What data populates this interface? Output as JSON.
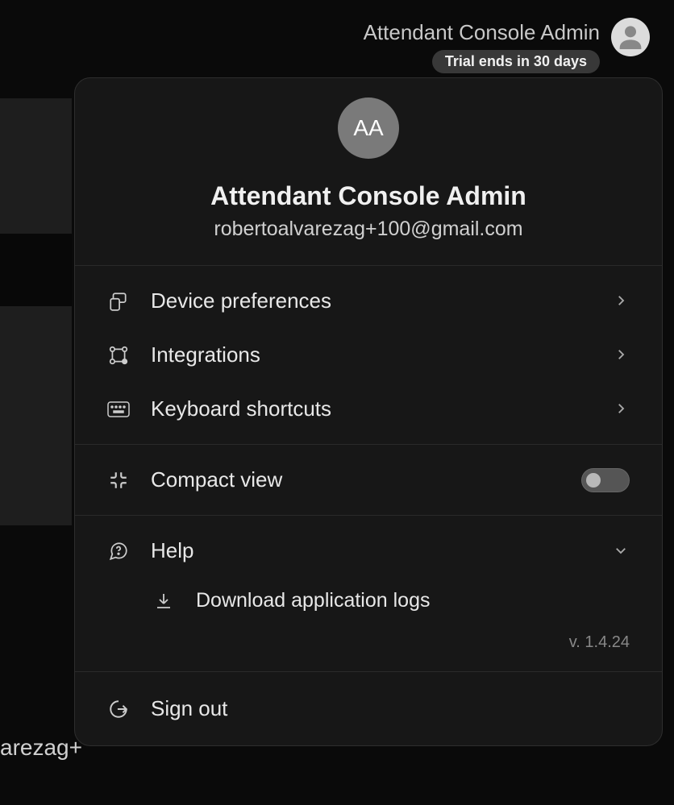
{
  "header": {
    "name": "Attendant Console Admin",
    "trial_badge": "Trial ends in 30 days"
  },
  "background_text": "arezag+",
  "profile": {
    "initials": "AA",
    "name": "Attendant Console Admin",
    "email": "robertoalvarezag+100@gmail.com"
  },
  "menu": {
    "device_preferences": "Device preferences",
    "integrations": "Integrations",
    "keyboard_shortcuts": "Keyboard shortcuts",
    "compact_view": "Compact view",
    "help": "Help",
    "download_logs": "Download application logs",
    "sign_out": "Sign out"
  },
  "version": "v. 1.4.24"
}
